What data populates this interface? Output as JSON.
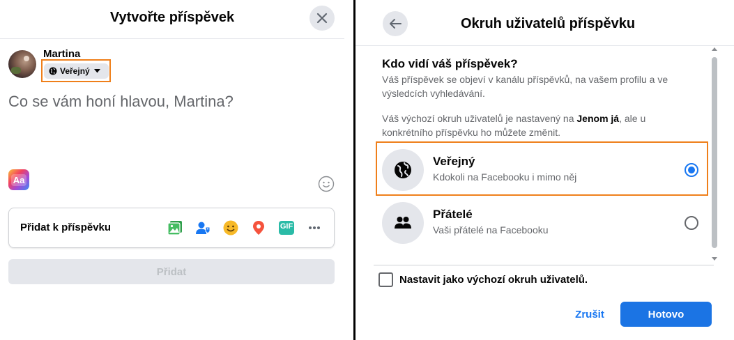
{
  "left": {
    "title": "Vytvořte příspěvek",
    "user_name": "Martina",
    "privacy_label": "Veřejný",
    "compose_placeholder": "Co se vám honí hlavou, Martina?",
    "text_format_label": "Aa",
    "add_to_post_label": "Přidat k příspěvku",
    "add_icons": [
      "photo-video-icon",
      "tag-people-icon",
      "feeling-activity-icon",
      "check-in-icon",
      "gif-icon",
      "more-icon"
    ],
    "gif_label": "GIF",
    "submit_label": "Přidat"
  },
  "right": {
    "title": "Okruh uživatelů příspěvku",
    "question": "Kdo vidí váš příspěvek?",
    "desc1": "Váš příspěvek se objeví v kanálu příspěvků, na vašem profilu a ve výsledcích vyhledávání.",
    "desc2_prefix": "Váš výchozí okruh uživatelů je nastavený na ",
    "desc2_bold": "Jenom já",
    "desc2_suffix": ", ale u konkrétního příspěvku ho můžete změnit.",
    "options": [
      {
        "title": "Veřejný",
        "subtitle": "Kdokoli na Facebooku i mimo něj",
        "icon": "globe-icon",
        "selected": true
      },
      {
        "title": "Přátelé",
        "subtitle": "Vaši přátelé na Facebooku",
        "icon": "friends-icon",
        "selected": false
      }
    ],
    "default_checkbox_label": "Nastavit jako výchozí okruh uživatelů.",
    "default_checked": false,
    "cancel_label": "Zrušit",
    "done_label": "Hotovo"
  },
  "colors": {
    "highlight": "#ef7f1a",
    "primary": "#1b74e4",
    "link": "#1877f2",
    "secondary_text": "#65676b",
    "button_bg": "#e4e6eb"
  }
}
